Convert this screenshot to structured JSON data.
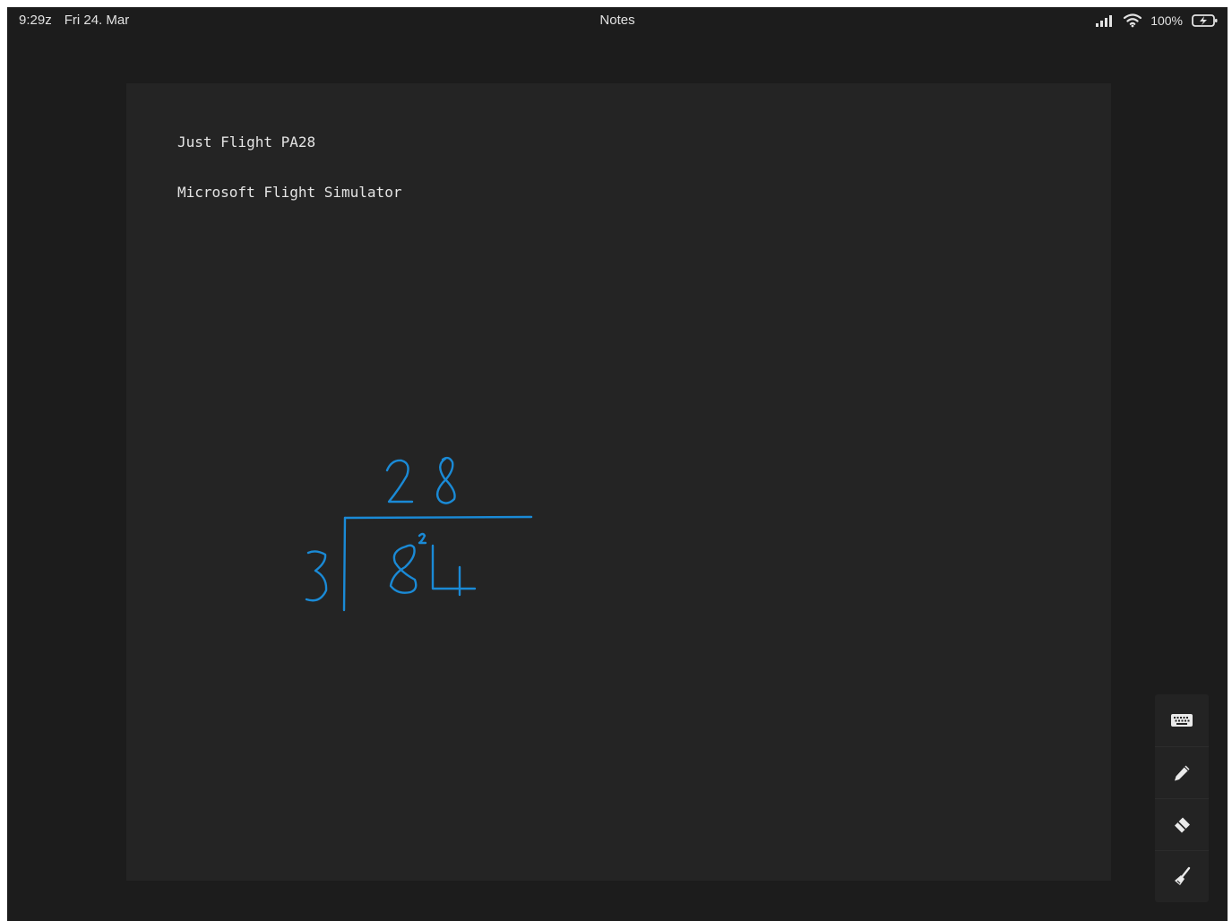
{
  "status_bar": {
    "time": "9:29z",
    "date": "Fri 24. Mar",
    "app_title": "Notes",
    "battery": "100%",
    "icons": [
      "signal-icon",
      "wifi-icon",
      "battery-charging-icon"
    ]
  },
  "note": {
    "lines": [
      "Just Flight PA28",
      "Microsoft Flight Simulator"
    ],
    "handwriting": {
      "color": "#1a8ad6",
      "quotient": "28",
      "divisor": "3",
      "dividend": "84",
      "carry": "2"
    }
  },
  "toolbar": {
    "tools": [
      "keyboard-icon",
      "pencil-icon",
      "eraser-icon",
      "broom-icon"
    ]
  },
  "colors": {
    "background": "#1c1c1c",
    "page": "#242424",
    "ink": "#1a8ad6",
    "text": "#e4e4e4"
  }
}
